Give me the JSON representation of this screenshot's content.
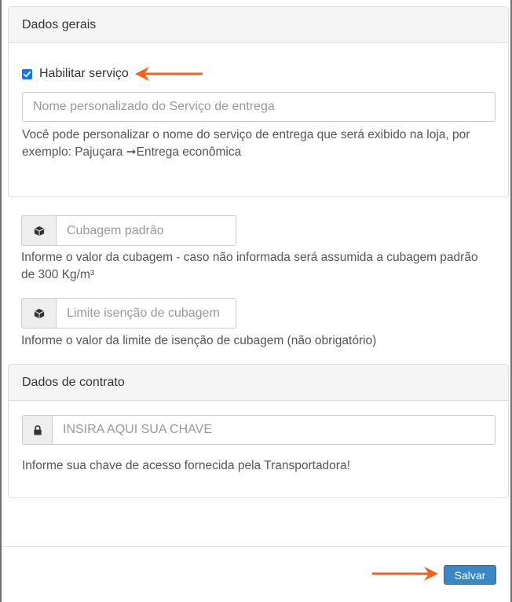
{
  "general": {
    "title": "Dados gerais",
    "enable_label": "Habilitar serviço",
    "enabled": true,
    "service_name_placeholder": "Nome personalizado do Serviço de entrega",
    "service_help": "Você pode personalizar o nome do serviço de entrega que será exibido na loja, por exemplo: Pajuçara ➞Entrega econômica"
  },
  "cubage": {
    "default_placeholder": "Cubagem padrão",
    "default_help": "Informe o valor da cubagem - caso não informada será assumida a cubagem padrão de 300 Kg/m³",
    "limit_placeholder": "Limite isenção de cubagem",
    "limit_help": "Informe o valor da limite de isenção de cubagem (não obrigatório)",
    "icon": "cube-icon"
  },
  "contract": {
    "title": "Dados de contrato",
    "key_placeholder": "INSIRA AQUI SUA CHAVE",
    "key_help": "Informe sua chave de acesso fornecida pela Transportadora!",
    "icon": "lock-icon"
  },
  "footer": {
    "save_label": "Salvar"
  },
  "colors": {
    "annotation_arrow": "#f2611d",
    "primary_button": "#3a87c8",
    "checkbox": "#1a73e8"
  }
}
